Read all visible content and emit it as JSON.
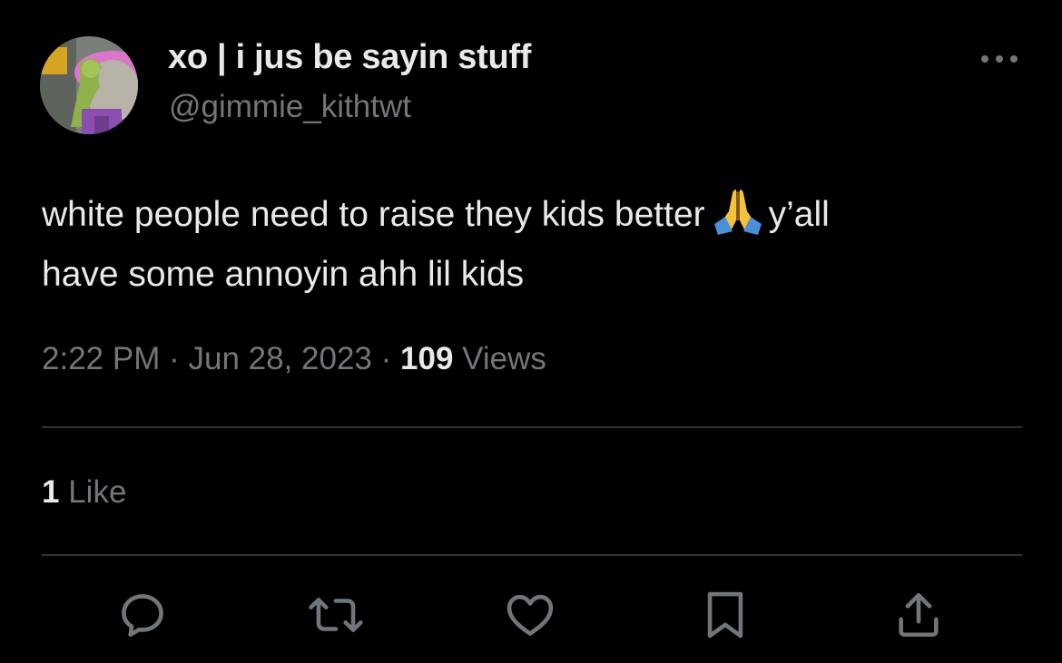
{
  "author": {
    "display_name": "xo | i jus be sayin stuff",
    "handle": "@gimmie_kithtwt",
    "avatar_icon": "profile-avatar"
  },
  "tweet": {
    "line1_before_emoji": "white people need to raise they kids better",
    "emoji": "folded-hands-emoji",
    "line1_after_emoji": "y’all",
    "line2": "have some annoyin ahh lil kids"
  },
  "meta": {
    "time": "2:22 PM",
    "separator": "·",
    "date": "Jun 28, 2023",
    "views_count": "109",
    "views_label": "Views"
  },
  "engagement": {
    "likes_count": "1",
    "likes_label": "Like"
  },
  "actions": [
    "reply-icon",
    "retweet-icon",
    "like-icon",
    "bookmark-icon",
    "share-icon"
  ],
  "colors": {
    "background": "#000000",
    "text_primary": "#e7e9ea",
    "text_secondary": "#71767b",
    "divider": "#2f3336"
  }
}
